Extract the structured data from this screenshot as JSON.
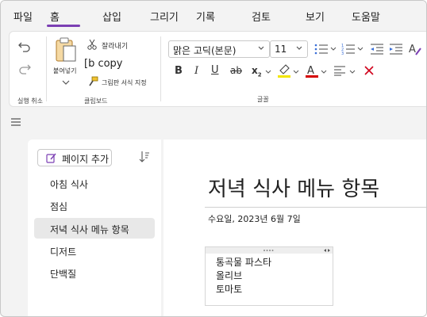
{
  "menu": {
    "items": [
      "파일",
      "홈",
      "삽입",
      "그리기",
      "기록",
      "검토",
      "보기",
      "도움말"
    ],
    "active": "홈"
  },
  "ribbon": {
    "undo_group_label": "실행 취소",
    "clipboard": {
      "paste_label": "붙여넣기",
      "cut_label": "잘라내기",
      "copy_label": "[b copy",
      "format_painter_label": "그림판 서식 지정",
      "group_label": "클립보드"
    },
    "font": {
      "font_name": "맑은 고딕(본문)",
      "font_size": "11",
      "group_label": "글꼴"
    },
    "colors": {
      "highlight": "#f2e600",
      "font_color": "#d40000",
      "accent": "#7b3fb3",
      "clear": "#d0021b"
    }
  },
  "pages_panel": {
    "add_page_label": "페이지 추가",
    "pages": [
      "아침 식사",
      "점심",
      "저녁 식사 메뉴 항목",
      "디저트",
      "단백질"
    ],
    "selected_index": 2
  },
  "page": {
    "title": "저녁 식사 메뉴 항목",
    "date": "수요일, 2023년 6월 7일",
    "note_lines": [
      "통곡물 파스타",
      "올리브",
      "토마토"
    ]
  }
}
